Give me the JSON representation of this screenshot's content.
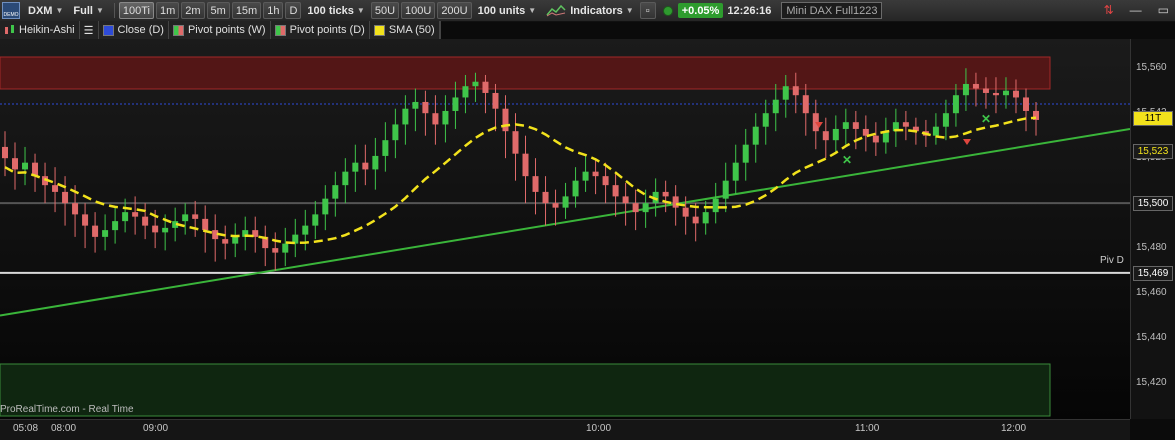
{
  "toolbar": {
    "demo_badge": "DEMO",
    "ticker": "DXM",
    "mode": "Full",
    "tf_buttons": [
      "100Ti",
      "1m",
      "2m",
      "5m",
      "15m",
      "1h",
      "D"
    ],
    "ticks_select": "100 ticks",
    "unit_buttons": [
      "50U",
      "100U",
      "200U"
    ],
    "units_select": "100 units",
    "indicators_label": "Indicators",
    "change_pct": "+0.05%",
    "time": "12:26:16",
    "instrument": "Mini DAX Full1223"
  },
  "legend": {
    "chart_type": "Heikin-Ashi",
    "items": [
      {
        "label": "Close (D)",
        "color": "#2e4bd8"
      },
      {
        "label": "Pivot points (W)",
        "color": "#d04040"
      },
      {
        "label": "Pivot points (D)",
        "color": "#d04040"
      },
      {
        "label": "SMA (50)",
        "color": "#f2e21c"
      }
    ]
  },
  "watermark": "Mini DAX Full1223",
  "footer_text": "ProRealTime.com - Real Time",
  "piv_label": "Piv D",
  "chart_data": {
    "type": "candlestick",
    "y_ticks": [
      15560,
      15540,
      15520,
      15500,
      15480,
      15460,
      15440,
      15420
    ],
    "y_tick_labels": [
      "15,560",
      "15,542",
      "15,520",
      "15,500",
      "15,480",
      "15,460",
      "15,440",
      "15,420"
    ],
    "x_tick_labels": [
      "05:08",
      "08:00",
      "09:00",
      "10:00",
      "11:00",
      "12:00"
    ],
    "price_boxes": [
      {
        "label": "11T",
        "value": 15538,
        "bg": "#f2e21c",
        "fg": "#000"
      },
      {
        "label": "15,523",
        "value": 15523,
        "bg": "#1a1a1a",
        "fg": "#f2e21c"
      },
      {
        "label": "15,500",
        "value": 15500,
        "bg": "#1a1a1a",
        "fg": "#ffffff"
      },
      {
        "label": "15,469",
        "value": 15469,
        "bg": "#1a1a1a",
        "fg": "#ffffff"
      }
    ],
    "ylim": [
      15404,
      15573
    ],
    "colors": {
      "up": "#3fc54a",
      "down": "#e06a6a",
      "sma": "#f2e21c",
      "trend": "#3ab53a"
    },
    "candles": [
      [
        15525,
        15520,
        15532,
        15512
      ],
      [
        15520,
        15515,
        15527,
        15506
      ],
      [
        15515,
        15518,
        15525,
        15508
      ],
      [
        15518,
        15512,
        15522,
        15505
      ],
      [
        15512,
        15508,
        15518,
        15500
      ],
      [
        15508,
        15505,
        15516,
        15496
      ],
      [
        15505,
        15500,
        15512,
        15490
      ],
      [
        15500,
        15495,
        15508,
        15485
      ],
      [
        15495,
        15490,
        15500,
        15480
      ],
      [
        15490,
        15485,
        15496,
        15478
      ],
      [
        15485,
        15488,
        15495,
        15479
      ],
      [
        15488,
        15492,
        15498,
        15482
      ],
      [
        15492,
        15496,
        15502,
        15487
      ],
      [
        15496,
        15494,
        15503,
        15486
      ],
      [
        15494,
        15490,
        15500,
        15484
      ],
      [
        15490,
        15487,
        15497,
        15480
      ],
      [
        15487,
        15489,
        15495,
        15479
      ],
      [
        15489,
        15492,
        15498,
        15483
      ],
      [
        15492,
        15495,
        15500,
        15486
      ],
      [
        15495,
        15493,
        15501,
        15485
      ],
      [
        15493,
        15488,
        15499,
        15478
      ],
      [
        15488,
        15484,
        15495,
        15474
      ],
      [
        15484,
        15482,
        15490,
        15475
      ],
      [
        15482,
        15485,
        15491,
        15476
      ],
      [
        15485,
        15488,
        15494,
        15479
      ],
      [
        15488,
        15485,
        15494,
        15478
      ],
      [
        15485,
        15480,
        15490,
        15472
      ],
      [
        15480,
        15478,
        15487,
        15470
      ],
      [
        15478,
        15482,
        15489,
        15472
      ],
      [
        15482,
        15486,
        15493,
        15476
      ],
      [
        15486,
        15490,
        15497,
        15479
      ],
      [
        15490,
        15495,
        15501,
        15484
      ],
      [
        15495,
        15502,
        15508,
        15488
      ],
      [
        15502,
        15508,
        15514,
        15494
      ],
      [
        15508,
        15514,
        15520,
        15500
      ],
      [
        15514,
        15518,
        15526,
        15505
      ],
      [
        15518,
        15515,
        15526,
        15508
      ],
      [
        15515,
        15521,
        15529,
        15506
      ],
      [
        15521,
        15528,
        15536,
        15514
      ],
      [
        15528,
        15535,
        15542,
        15520
      ],
      [
        15535,
        15542,
        15548,
        15526
      ],
      [
        15542,
        15545,
        15551,
        15532
      ],
      [
        15545,
        15540,
        15550,
        15530
      ],
      [
        15540,
        15535,
        15548,
        15526
      ],
      [
        15535,
        15541,
        15548,
        15527
      ],
      [
        15541,
        15547,
        15554,
        15533
      ],
      [
        15547,
        15552,
        15557,
        15540
      ],
      [
        15552,
        15554,
        15558,
        15545
      ],
      [
        15554,
        15549,
        15557,
        15540
      ],
      [
        15549,
        15542,
        15553,
        15532
      ],
      [
        15542,
        15532,
        15548,
        15520
      ],
      [
        15532,
        15522,
        15540,
        15510
      ],
      [
        15522,
        15512,
        15530,
        15500
      ],
      [
        15512,
        15505,
        15520,
        15495
      ],
      [
        15505,
        15500,
        15512,
        15490
      ],
      [
        15500,
        15498,
        15506,
        15490
      ],
      [
        15498,
        15503,
        15509,
        15493
      ],
      [
        15503,
        15510,
        15516,
        15498
      ],
      [
        15510,
        15514,
        15521,
        15505
      ],
      [
        15514,
        15512,
        15519,
        15504
      ],
      [
        15512,
        15508,
        15518,
        15500
      ],
      [
        15508,
        15503,
        15513,
        15494
      ],
      [
        15503,
        15500,
        15509,
        15490
      ],
      [
        15500,
        15496,
        15506,
        15488
      ],
      [
        15496,
        15500,
        15506,
        15489
      ],
      [
        15500,
        15505,
        15511,
        15494
      ],
      [
        15505,
        15503,
        15510,
        15496
      ],
      [
        15503,
        15498,
        15508,
        15490
      ],
      [
        15498,
        15494,
        15503,
        15486
      ],
      [
        15494,
        15491,
        15500,
        15483
      ],
      [
        15491,
        15496,
        15501,
        15486
      ],
      [
        15496,
        15502,
        15509,
        15491
      ],
      [
        15502,
        15510,
        15518,
        15496
      ],
      [
        15510,
        15518,
        15526,
        15504
      ],
      [
        15518,
        15526,
        15533,
        15510
      ],
      [
        15526,
        15534,
        15540,
        15518
      ],
      [
        15534,
        15540,
        15546,
        15526
      ],
      [
        15540,
        15546,
        15553,
        15532
      ],
      [
        15546,
        15552,
        15557,
        15538
      ],
      [
        15552,
        15548,
        15558,
        15540
      ],
      [
        15548,
        15540,
        15553,
        15530
      ],
      [
        15540,
        15532,
        15546,
        15524
      ],
      [
        15532,
        15528,
        15538,
        15520
      ],
      [
        15528,
        15533,
        15539,
        15522
      ],
      [
        15533,
        15536,
        15542,
        15526
      ],
      [
        15536,
        15533,
        15541,
        15524
      ],
      [
        15533,
        15530,
        15539,
        15523
      ],
      [
        15530,
        15527,
        15536,
        15521
      ],
      [
        15527,
        15532,
        15538,
        15522
      ],
      [
        15532,
        15536,
        15542,
        15525
      ],
      [
        15536,
        15534,
        15541,
        15528
      ],
      [
        15534,
        15532,
        15538,
        15526
      ],
      [
        15532,
        15530,
        15537,
        15525
      ],
      [
        15530,
        15534,
        15540,
        15526
      ],
      [
        15534,
        15540,
        15546,
        15528
      ],
      [
        15540,
        15548,
        15553,
        15534
      ],
      [
        15548,
        15553,
        15560,
        15541
      ],
      [
        15553,
        15551,
        15558,
        15543
      ],
      [
        15551,
        15549,
        15556,
        15542
      ],
      [
        15549,
        15548,
        15556,
        15540
      ],
      [
        15548,
        15550,
        15556,
        15542
      ],
      [
        15550,
        15547,
        15555,
        15540
      ],
      [
        15547,
        15541,
        15551,
        15532
      ],
      [
        15541,
        15537,
        15545,
        15530
      ]
    ]
  }
}
